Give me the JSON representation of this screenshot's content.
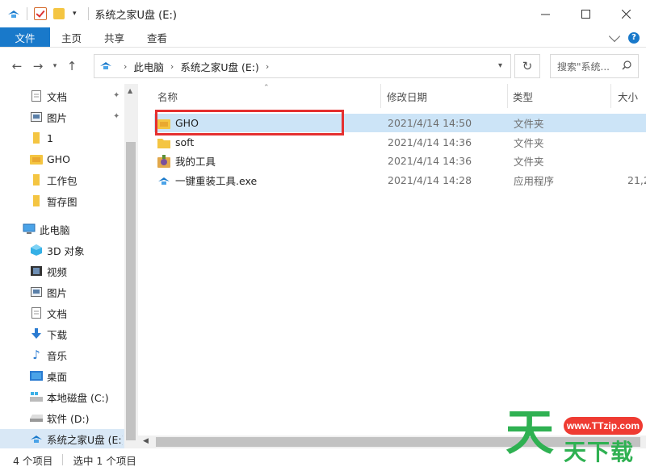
{
  "title_bar": {
    "title": "系统之家U盘 (E:)",
    "controls": [
      "minimize",
      "maximize",
      "close"
    ]
  },
  "ribbon": {
    "tabs": [
      "文件",
      "主页",
      "共享",
      "查看"
    ],
    "help_label": "?"
  },
  "address": {
    "crumbs": [
      "此电脑",
      "系统之家U盘 (E:)"
    ],
    "search_placeholder": "搜索\"系统...",
    "icons": {
      "back": "back-arrow-icon",
      "forward": "forward-arrow-icon",
      "up": "up-arrow-icon",
      "refresh": "refresh-icon"
    }
  },
  "sidebar": {
    "items": [
      {
        "label": "文档",
        "icon": "documents-icon",
        "pinned": true
      },
      {
        "label": "图片",
        "icon": "pictures-icon",
        "pinned": true
      },
      {
        "label": "1",
        "icon": "folder-icon",
        "pinned": false
      },
      {
        "label": "GHO",
        "icon": "gho-folder-icon",
        "pinned": false
      },
      {
        "label": "工作包",
        "icon": "folder-icon",
        "pinned": false
      },
      {
        "label": "暂存图",
        "icon": "folder-icon",
        "pinned": false
      },
      {
        "label": "此电脑",
        "icon": "this-pc-icon",
        "pinned": false
      },
      {
        "label": "3D 对象",
        "icon": "3d-objects-icon",
        "pinned": false
      },
      {
        "label": "视频",
        "icon": "videos-icon",
        "pinned": false
      },
      {
        "label": "图片",
        "icon": "pictures-icon",
        "pinned": false
      },
      {
        "label": "文档",
        "icon": "documents-icon",
        "pinned": false
      },
      {
        "label": "下载",
        "icon": "downloads-icon",
        "pinned": false
      },
      {
        "label": "音乐",
        "icon": "music-icon",
        "pinned": false
      },
      {
        "label": "桌面",
        "icon": "desktop-icon",
        "pinned": false
      },
      {
        "label": "本地磁盘 (C:)",
        "icon": "local-disk-icon",
        "pinned": false
      },
      {
        "label": "软件 (D:)",
        "icon": "drive-icon",
        "pinned": false
      },
      {
        "label": "系统之家U盘 (E:)",
        "icon": "usb-drive-icon",
        "pinned": false
      }
    ]
  },
  "columns": [
    "名称",
    "修改日期",
    "类型",
    "大小"
  ],
  "files": [
    {
      "name": "GHO",
      "date": "2021/4/14 14:50",
      "type": "文件夹",
      "size": "",
      "icon": "gho-folder-icon",
      "selected": true
    },
    {
      "name": "soft",
      "date": "2021/4/14 14:36",
      "type": "文件夹",
      "size": "",
      "icon": "folder-icon",
      "selected": false
    },
    {
      "name": "我的工具",
      "date": "2021/4/14 14:36",
      "type": "文件夹",
      "size": "",
      "icon": "tools-folder-icon",
      "selected": false
    },
    {
      "name": "一键重装工具.exe",
      "date": "2021/4/14 14:28",
      "type": "应用程序",
      "size": "21,2",
      "icon": "exe-icon",
      "selected": false
    }
  ],
  "status": {
    "count": "4 个项目",
    "selection": "选中 1 个项目"
  },
  "watermark": {
    "url": "www.TTzip.com",
    "big_char": "天",
    "small_text": "天下载"
  },
  "colors": {
    "accent": "#1979ca",
    "selection": "#cce4f7",
    "highlight_box": "#e53030",
    "folder": "#f4c542",
    "watermark_green": "#2fb152",
    "watermark_red": "#ef3b32"
  }
}
